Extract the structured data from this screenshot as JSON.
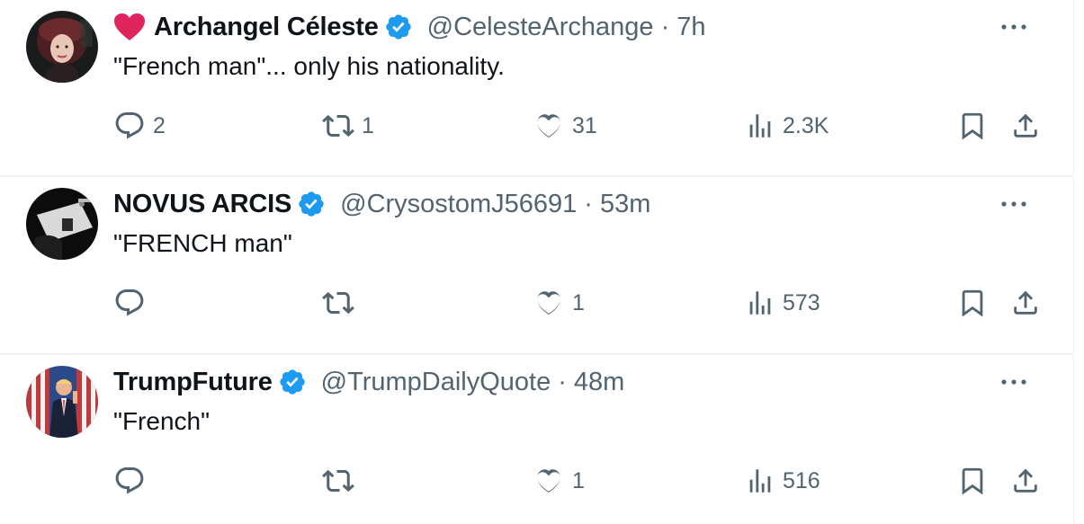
{
  "tweets": [
    {
      "name": "Archangel Céleste",
      "handle": "@CelesteArchange",
      "separator": "·",
      "time": "7h",
      "text": "\"French man\"... only his nationality.",
      "has_heart_emoji": true,
      "verified": true,
      "replies": "2",
      "retweets": "1",
      "likes": "31",
      "views": "2.3K"
    },
    {
      "name": "NOVUS ARCIS",
      "handle": "@CrysostomJ56691",
      "separator": "·",
      "time": "53m",
      "text": "\"FRENCH man\"",
      "has_heart_emoji": false,
      "verified": true,
      "replies": "",
      "retweets": "",
      "likes": "1",
      "views": "573"
    },
    {
      "name": "TrumpFuture",
      "handle": "@TrumpDailyQuote",
      "separator": "·",
      "time": "48m",
      "text": "\"French\"",
      "has_heart_emoji": false,
      "verified": true,
      "replies": "",
      "retweets": "",
      "likes": "1",
      "views": "516"
    }
  ],
  "icons": {
    "reply": "reply-icon",
    "retweet": "retweet-icon",
    "like": "like-icon",
    "views": "views-icon",
    "bookmark": "bookmark-icon",
    "share": "share-icon",
    "more": "more-icon",
    "verified": "verified-badge-icon",
    "heart_emoji": "red-heart-emoji-icon"
  },
  "colors": {
    "text_primary": "#0f1419",
    "text_secondary": "#536471",
    "verified_blue": "#1d9bf0",
    "heart_red": "#e0245e",
    "divider": "#eff3f4"
  }
}
